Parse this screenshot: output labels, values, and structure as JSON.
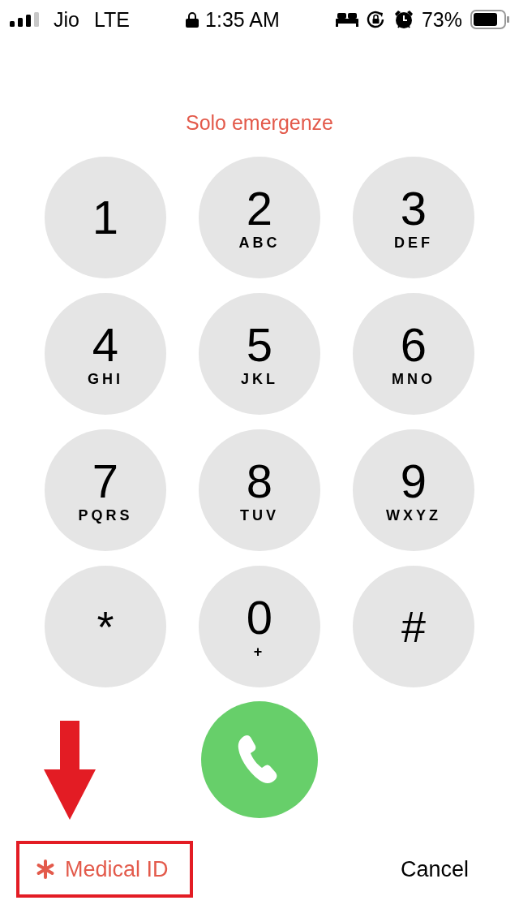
{
  "status_bar": {
    "carrier": "Jio",
    "network": "LTE",
    "time": "1:35 AM",
    "battery": "73%"
  },
  "title": "Solo emergenze",
  "keys": [
    {
      "digit": "1"
    },
    {
      "digit": "2",
      "letters": "ABC"
    },
    {
      "digit": "3",
      "letters": "DEF"
    },
    {
      "digit": "4",
      "letters": "GHI"
    },
    {
      "digit": "5",
      "letters": "JKL"
    },
    {
      "digit": "6",
      "letters": "MNO"
    },
    {
      "digit": "7",
      "letters": "PQRS"
    },
    {
      "digit": "8",
      "letters": "TUV"
    },
    {
      "digit": "9",
      "letters": "WXYZ"
    },
    {
      "digit": "*"
    },
    {
      "digit": "0",
      "letters": "+"
    },
    {
      "digit": "#"
    }
  ],
  "medical_id": "Medical ID",
  "cancel": "Cancel"
}
